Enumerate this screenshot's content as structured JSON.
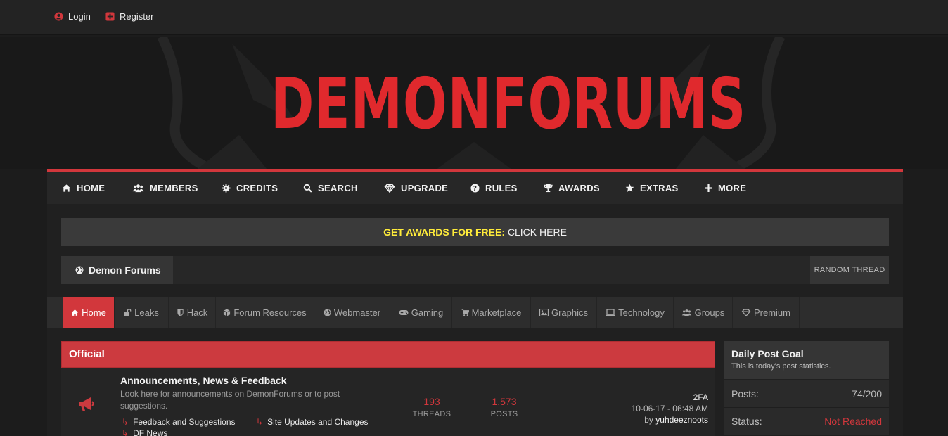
{
  "topbar": {
    "login_label": "Login",
    "register_label": "Register"
  },
  "logo": {
    "text": "DEMONFORUMS"
  },
  "main_nav": {
    "items": [
      {
        "label": "HOME",
        "icon": "home-icon"
      },
      {
        "label": "MEMBERS",
        "icon": "users-icon"
      },
      {
        "label": "CREDITS",
        "icon": "gear-icon"
      },
      {
        "label": "SEARCH",
        "icon": "search-icon"
      },
      {
        "label": "UPGRADE",
        "icon": "diamond-icon"
      },
      {
        "label": "RULES",
        "icon": "question-icon"
      },
      {
        "label": "AWARDS",
        "icon": "trophy-icon"
      },
      {
        "label": "EXTRAS",
        "icon": "star-icon"
      },
      {
        "label": "MORE",
        "icon": "plus-icon"
      }
    ]
  },
  "promo": {
    "highlight": "GET AWARDS FOR FREE:",
    "cta": "CLICK HERE"
  },
  "breadcrumb": {
    "label": "Demon Forums",
    "random_thread": "RANDOM THREAD"
  },
  "sub_nav": {
    "tabs": [
      {
        "label": "Home",
        "icon": "home-icon",
        "active": true
      },
      {
        "label": "Leaks",
        "icon": "unlock-icon"
      },
      {
        "label": "Hack",
        "icon": "shield-icon"
      },
      {
        "label": "Forum Resources",
        "icon": "cube-icon"
      },
      {
        "label": "Webmaster",
        "icon": "globe-icon"
      },
      {
        "label": "Gaming",
        "icon": "gamepad-icon"
      },
      {
        "label": "Marketplace",
        "icon": "cart-icon"
      },
      {
        "label": "Graphics",
        "icon": "image-icon"
      },
      {
        "label": "Technology",
        "icon": "laptop-icon"
      },
      {
        "label": "Groups",
        "icon": "users-icon"
      },
      {
        "label": "Premium",
        "icon": "diamond-icon"
      }
    ]
  },
  "forum": {
    "category": "Official",
    "rows": [
      {
        "title": "Announcements, News & Feedback",
        "description": "Look here for announcements on DemonForums or to post suggestions.",
        "subforums": [
          "Feedback and Suggestions",
          "Site Updates and Changes",
          "DF News"
        ],
        "threads": "193",
        "threads_label": "THREADS",
        "posts": "1,573",
        "posts_label": "POSTS",
        "last_title": "2FA",
        "last_date": "10-06-17 - 06:48 AM",
        "last_by_prefix": "by",
        "last_by": "yuhdeeznoots"
      }
    ]
  },
  "sidebar": {
    "title": "Daily Post Goal",
    "subtitle": "This is today's post statistics.",
    "posts_label": "Posts:",
    "posts_value": "74/200",
    "status_label": "Status:",
    "status_value": "Not Reached"
  },
  "colors": {
    "accent": "#d2373c",
    "promo_highlight": "#ffec3a",
    "background": "#1c1c1c"
  }
}
